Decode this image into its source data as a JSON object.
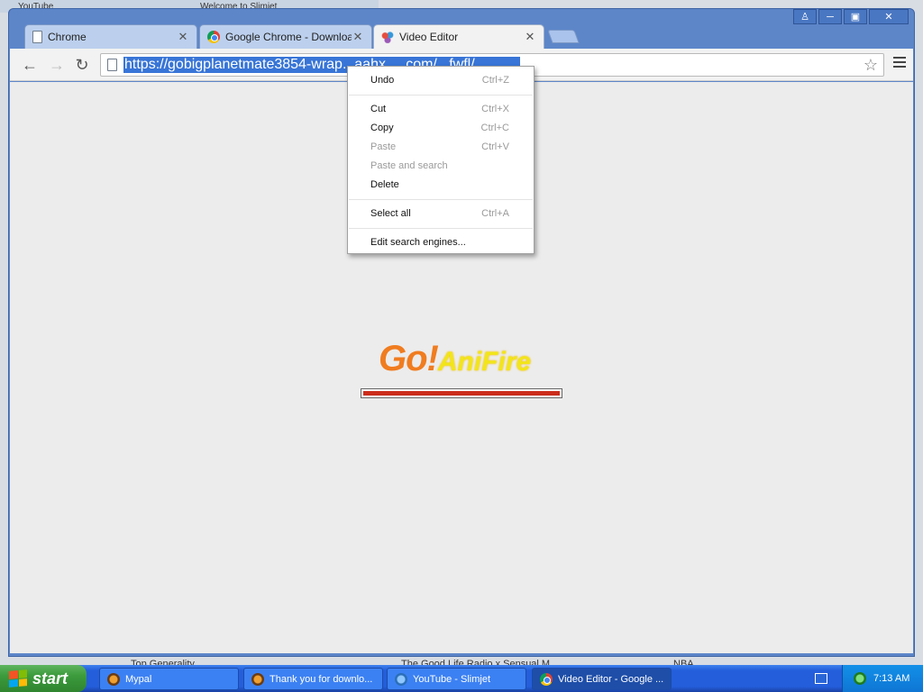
{
  "background": {
    "tabs": [
      "YouTube",
      "Welcome to Slimjet"
    ],
    "bookmarks": [
      "Top Generality",
      "The Good Life Radio x Sensual M...",
      "NBA"
    ]
  },
  "browser": {
    "tabs": [
      {
        "title": "Chrome",
        "icon": "page-icon",
        "close": "✕"
      },
      {
        "title": "Google Chrome - Download the",
        "icon": "chrome-logo-icon",
        "close": "✕"
      },
      {
        "title": "Video Editor",
        "icon": "video-editor-icon",
        "close": "✕",
        "active": true
      }
    ],
    "window_controls": [
      "user-icon",
      "minimize-icon",
      "maximize-icon",
      "close-icon"
    ],
    "window_control_glyphs": [
      "♙",
      "─",
      "▣",
      "✕"
    ],
    "nav": {
      "back": "←",
      "forward": "→",
      "reload": "↻"
    },
    "address": {
      "url": "https://gobigplanetmate3854-wrap...aahx.....com/...fwfl/"
    },
    "star": "☆"
  },
  "page": {
    "logo_go": "Go!",
    "logo_anifire": "AniFire",
    "progress": 1.0
  },
  "context_menu": {
    "items": [
      {
        "label": "Undo",
        "shortcut": "Ctrl+Z",
        "disabled": false
      },
      {
        "separator": true
      },
      {
        "label": "Cut",
        "shortcut": "Ctrl+X",
        "disabled": false
      },
      {
        "label": "Copy",
        "shortcut": "Ctrl+C",
        "disabled": false
      },
      {
        "label": "Paste",
        "shortcut": "Ctrl+V",
        "disabled": true
      },
      {
        "label": "Paste and search",
        "shortcut": "",
        "disabled": true
      },
      {
        "label": "Delete",
        "shortcut": "",
        "disabled": false
      },
      {
        "separator": true
      },
      {
        "label": "Select all",
        "shortcut": "Ctrl+A",
        "disabled": false
      },
      {
        "separator": true
      },
      {
        "label": "Edit search engines...",
        "shortcut": "",
        "disabled": false
      }
    ]
  },
  "taskbar": {
    "start": "start",
    "buttons": [
      {
        "label": "Mypal",
        "icon": "mypal-icon"
      },
      {
        "label": "Thank you for downlo...",
        "icon": "firefox-icon"
      },
      {
        "label": "YouTube - Slimjet",
        "icon": "slimjet-icon"
      },
      {
        "label": "Video Editor - Google ...",
        "icon": "chrome-logo-icon",
        "active": true
      }
    ],
    "clock": "7:13 AM"
  },
  "colors": {
    "selection": "#3875d7",
    "progress": "#cc2c1b",
    "logo_orange": "#f07c1f",
    "logo_yellow": "#f2e51a"
  }
}
